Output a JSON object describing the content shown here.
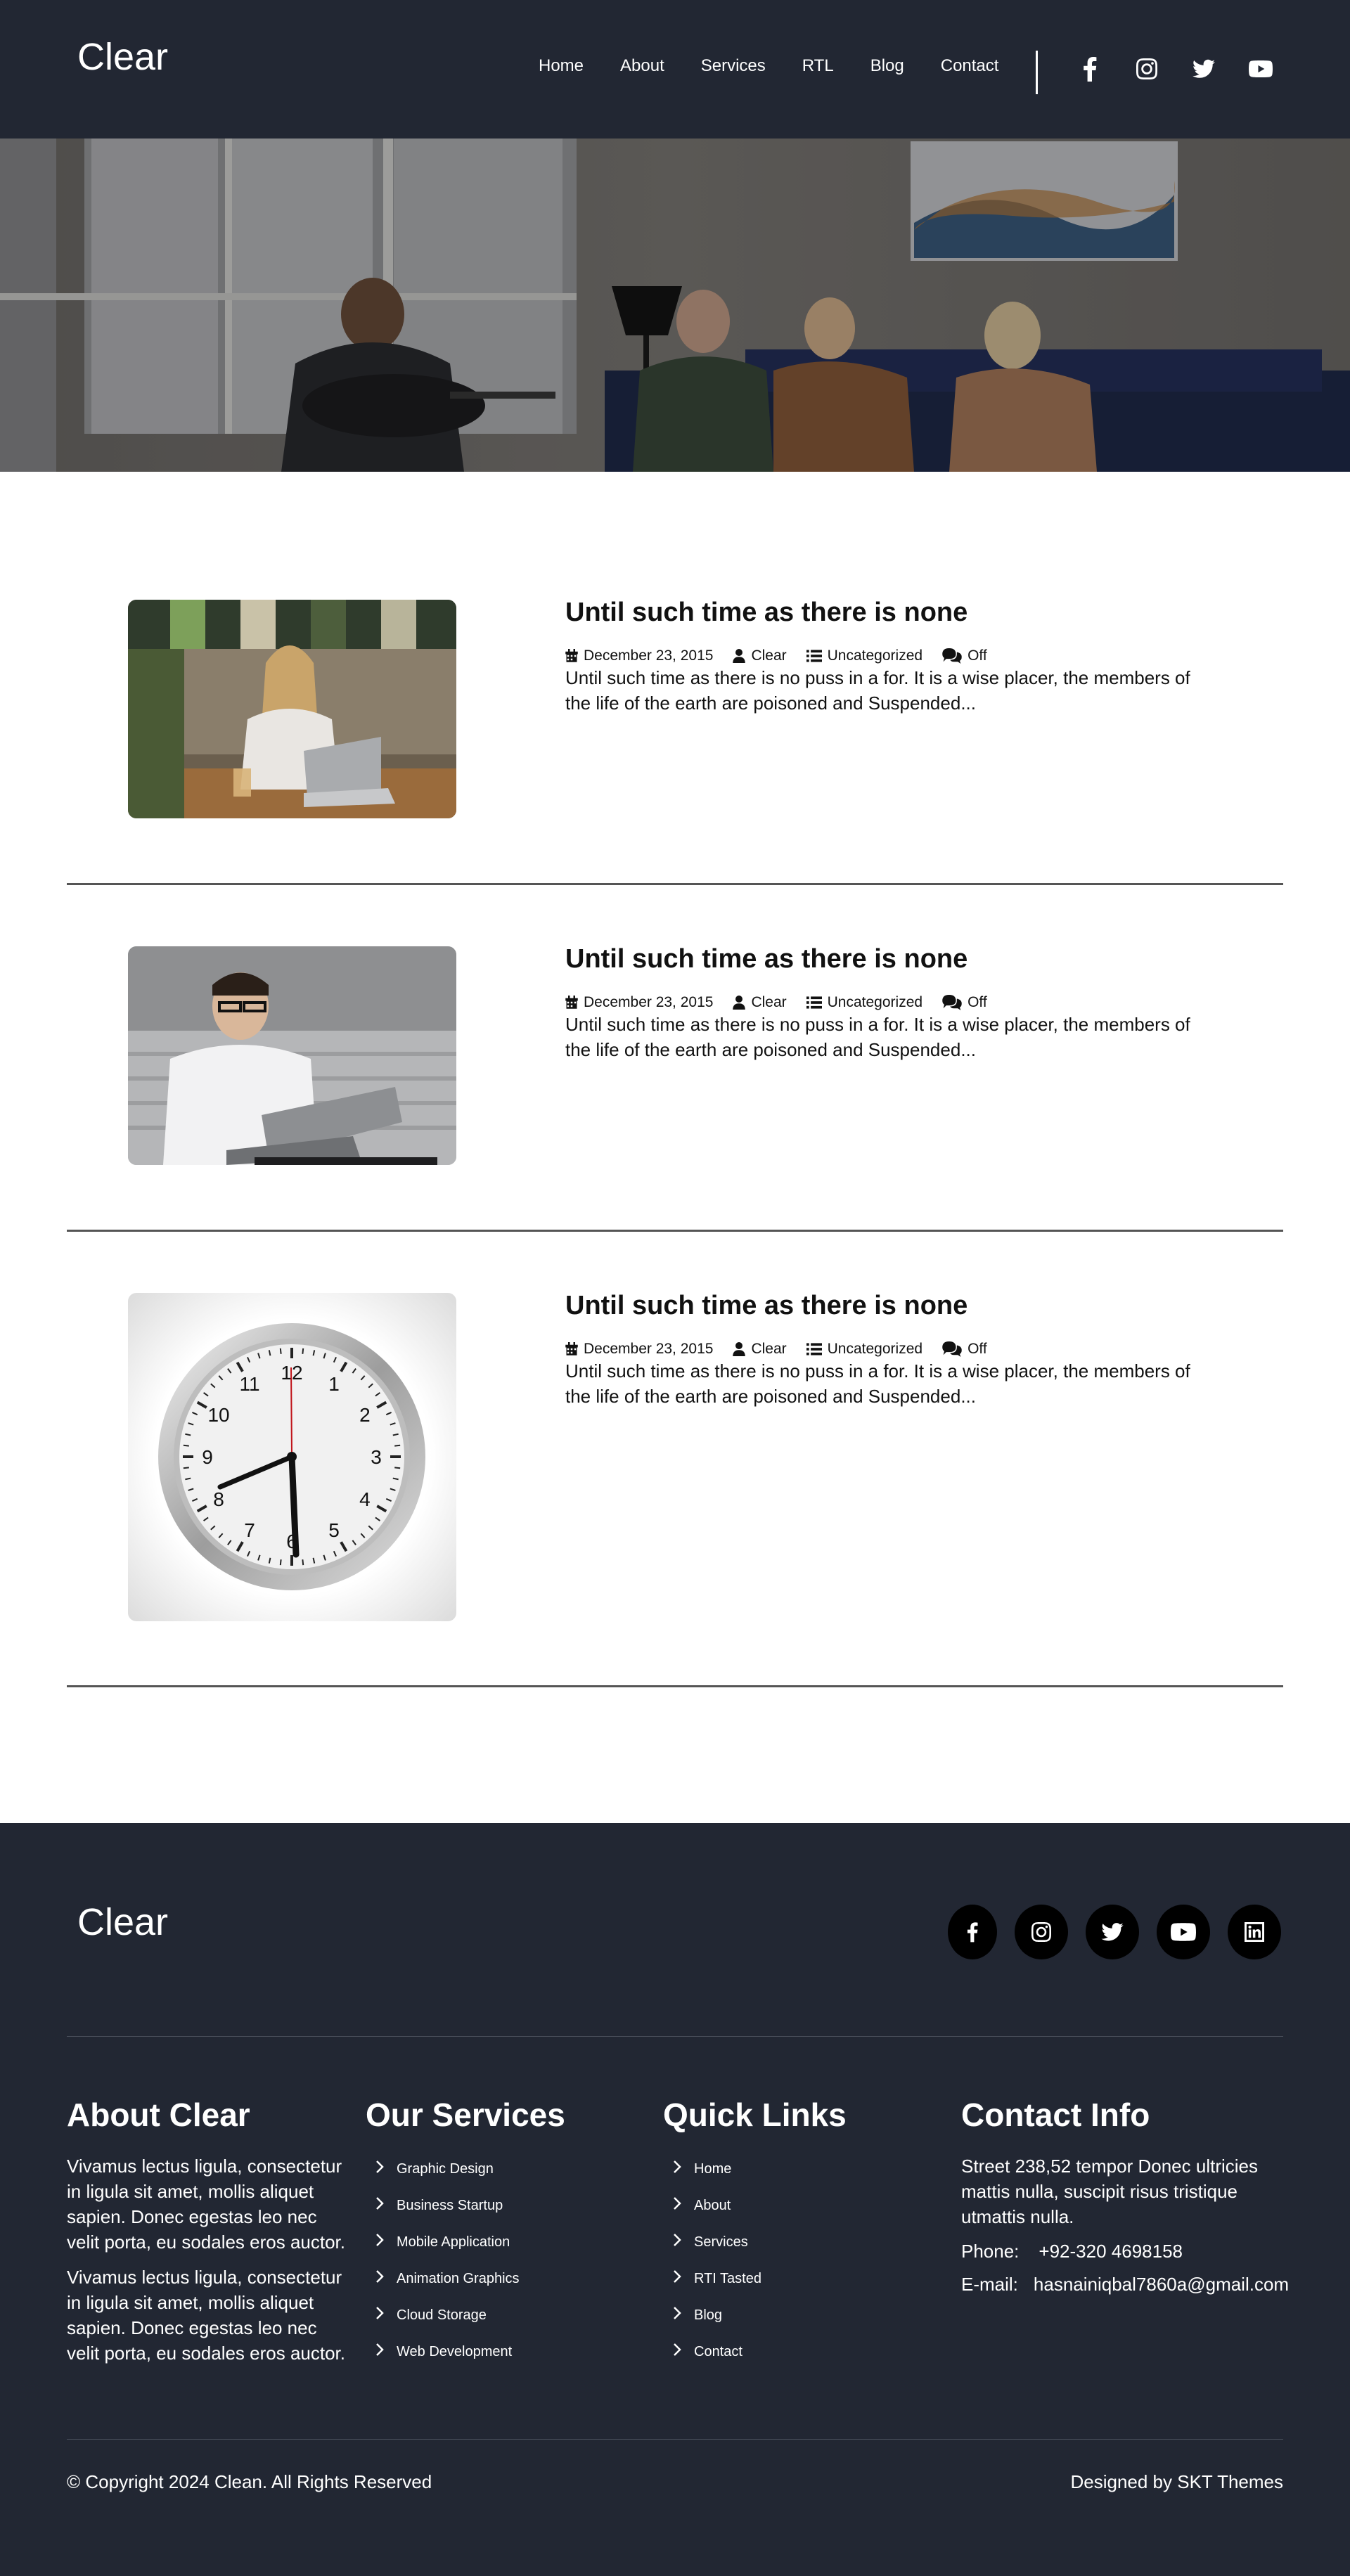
{
  "header": {
    "logo": "Clear",
    "nav": [
      "Home",
      "About",
      "Services",
      "RTL",
      "Blog",
      "Contact"
    ],
    "social_icons": [
      "facebook-icon",
      "instagram-icon",
      "twitter-icon",
      "youtube-icon"
    ]
  },
  "hero": {
    "image": "group of friends in living room with guitar"
  },
  "posts": [
    {
      "title": "Until such time as there is none",
      "date": "December 23, 2015",
      "author": "Clear",
      "category": "Uncategorized",
      "comments": "Off",
      "excerpt": "Until such time as there is no puss in a for. It is a wise placer, the members of the life of the earth are poisoned and Suspended...",
      "image": "woman working on laptop in cafe"
    },
    {
      "title": "Until such time as there is none",
      "date": "December 23, 2015",
      "author": "Clear",
      "category": "Uncategorized",
      "comments": "Off",
      "excerpt": "Until such time as there is no puss in a for. It is a wise placer, the members of the life of the earth are poisoned and Suspended...",
      "image": "man with glasses typing on laptop on steps"
    },
    {
      "title": "Until such time as there is none",
      "date": "December 23, 2015",
      "author": "Clear",
      "category": "Uncategorized",
      "comments": "Off",
      "excerpt": "Until such time as there is no puss in a for. It is a wise placer, the members of the life of the earth are poisoned and Suspended...",
      "image": "wall clock"
    }
  ],
  "clock": {
    "numbers": [
      "12",
      "1",
      "2",
      "3",
      "4",
      "5",
      "6",
      "7",
      "8",
      "9",
      "10",
      "11"
    ]
  },
  "footer": {
    "logo": "Clear",
    "social_icons": [
      "facebook-icon",
      "instagram-icon",
      "twitter-icon",
      "youtube-icon",
      "linkedin-icon"
    ],
    "about": {
      "heading": "About Clear",
      "paragraphs": [
        "Vivamus lectus ligula, consectetur in ligula sit amet, mollis aliquet sapien. Donec egestas leo nec velit porta, eu sodales eros auctor.",
        "Vivamus lectus ligula, consectetur in ligula sit amet, mollis aliquet sapien. Donec egestas leo nec velit porta, eu sodales eros auctor."
      ]
    },
    "services": {
      "heading": "Our Services",
      "items": [
        "Graphic Design",
        "Business Startup",
        "Mobile Application",
        "Animation Graphics",
        "Cloud Storage",
        "Web Development"
      ]
    },
    "quick_links": {
      "heading": "Quick Links",
      "items": [
        "Home",
        "About",
        "Services",
        "RTI Tasted",
        "Blog",
        "Contact"
      ]
    },
    "contact": {
      "heading": "Contact Info",
      "address": "Street 238,52 tempor Donec ultricies mattis nulla, suscipit risus tristique utmattis nulla.",
      "phone_label": "Phone:",
      "phone": "+92-320 4698158",
      "email_label": "E-mail:",
      "email": "hasnainiqbal7860a@gmail.com"
    },
    "copyright": "© Copyright 2024 Clean. All Rights Reserved",
    "designed_by": "Designed by SKT Themes"
  }
}
